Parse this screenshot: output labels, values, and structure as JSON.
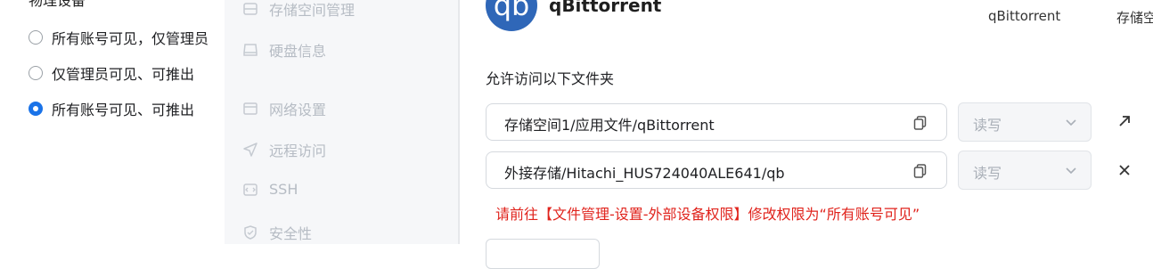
{
  "left": {
    "cut_heading": "物理设备",
    "options": [
      {
        "label": "所有账号可见，仅管理员",
        "checked": false
      },
      {
        "label": "仅管理员可见、可推出",
        "checked": false
      },
      {
        "label": "所有账号可见、可推出",
        "checked": true
      }
    ]
  },
  "nav": {
    "items": [
      {
        "label": "存储空间管理",
        "icon": "storage-icon"
      },
      {
        "label": "硬盘信息",
        "icon": "disk-icon"
      },
      {
        "label": "网络设置",
        "icon": "network-icon"
      },
      {
        "label": "远程访问",
        "icon": "send-icon"
      },
      {
        "label": "SSH",
        "icon": "code-icon"
      },
      {
        "label": "安全性",
        "icon": "shield-icon"
      }
    ]
  },
  "app": {
    "logo_text": "qb",
    "name": "qBittorrent",
    "tabs": [
      "qBittorrent",
      "存储空"
    ]
  },
  "folders": {
    "section_label": "允许访问以下文件夹",
    "rows": [
      {
        "path": "存储空间1/应用文件/qBittorrent",
        "permission": "读写",
        "action_icon": "arrow-up-right-icon"
      },
      {
        "path": "外接存储/Hitachi_HUS724040ALE641/qb",
        "permission": "读写",
        "action_icon": "close-icon"
      }
    ],
    "warning": "请前往【文件管理-设置-外部设备权限】修改权限为“所有账号可见”"
  },
  "colors": {
    "accent": "#1a73e8",
    "warning": "#e0231c",
    "logo": "#2f67b8"
  }
}
